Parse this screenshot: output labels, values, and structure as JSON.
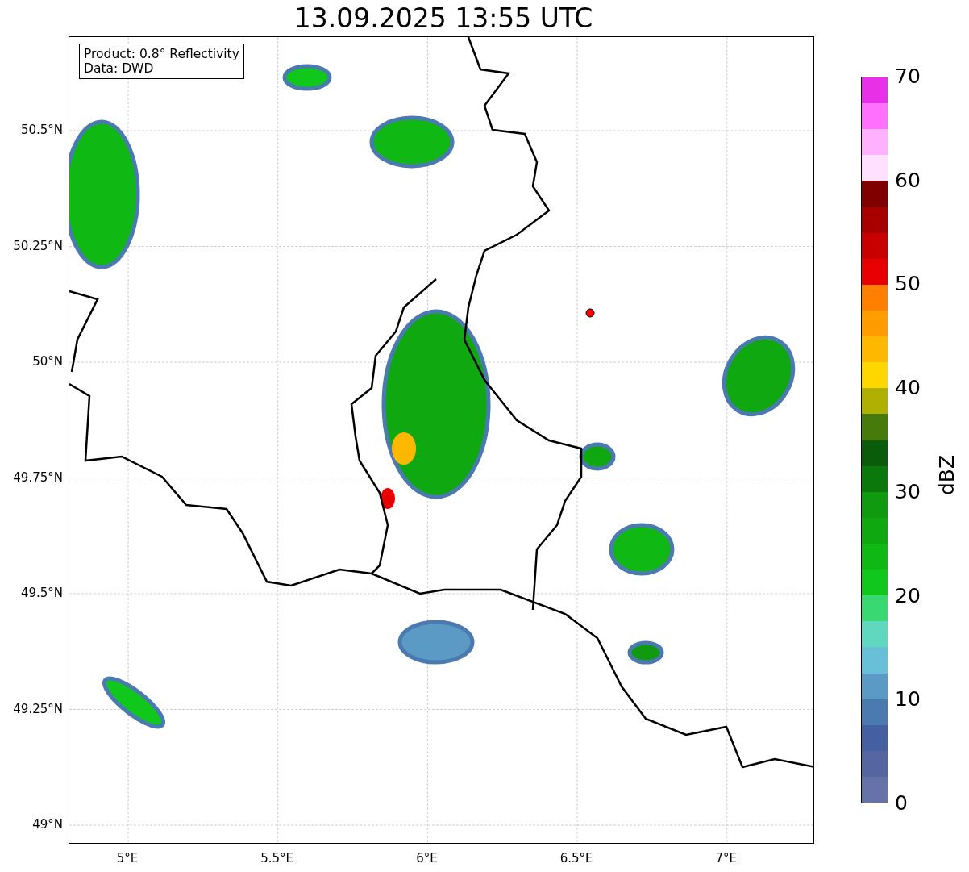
{
  "title": "13.09.2025 13:55 UTC",
  "info_box": {
    "lines": [
      "Product: 0.8° Reflectivity",
      "Data: DWD"
    ]
  },
  "map": {
    "lat_ticks": [
      "50.5°N",
      "50.25°N",
      "50°N",
      "49.75°N",
      "49.5°N",
      "49.25°N",
      "49°N"
    ],
    "lon_ticks": [
      "5°E",
      "5.5°E",
      "6°E",
      "6.5°E",
      "7°E"
    ]
  },
  "colorbar": {
    "label": "dBZ",
    "ticks": [
      "70",
      "60",
      "50",
      "40",
      "30",
      "20",
      "10",
      "0"
    ],
    "levels": [
      {
        "color": "#e830e8"
      },
      {
        "color": "#ff70ff"
      },
      {
        "color": "#ffb0ff"
      },
      {
        "color": "#ffe0ff"
      },
      {
        "color": "#800000"
      },
      {
        "color": "#a80000"
      },
      {
        "color": "#c80000"
      },
      {
        "color": "#e80000"
      },
      {
        "color": "#ff7f00"
      },
      {
        "color": "#ff9c00"
      },
      {
        "color": "#ffb800"
      },
      {
        "color": "#ffd700"
      },
      {
        "color": "#b0b000"
      },
      {
        "color": "#467a0a"
      },
      {
        "color": "#0a5c0a"
      },
      {
        "color": "#0b780b"
      },
      {
        "color": "#0f9a10"
      },
      {
        "color": "#10a810"
      },
      {
        "color": "#10b814"
      },
      {
        "color": "#10c81c"
      },
      {
        "color": "#3ad870"
      },
      {
        "color": "#60d8c0"
      },
      {
        "color": "#68c0d8"
      },
      {
        "color": "#5a9ac4"
      },
      {
        "color": "#4a7ab0"
      },
      {
        "color": "#4560a0"
      },
      {
        "color": "#5565a0"
      },
      {
        "color": "#6673a8"
      }
    ]
  }
}
